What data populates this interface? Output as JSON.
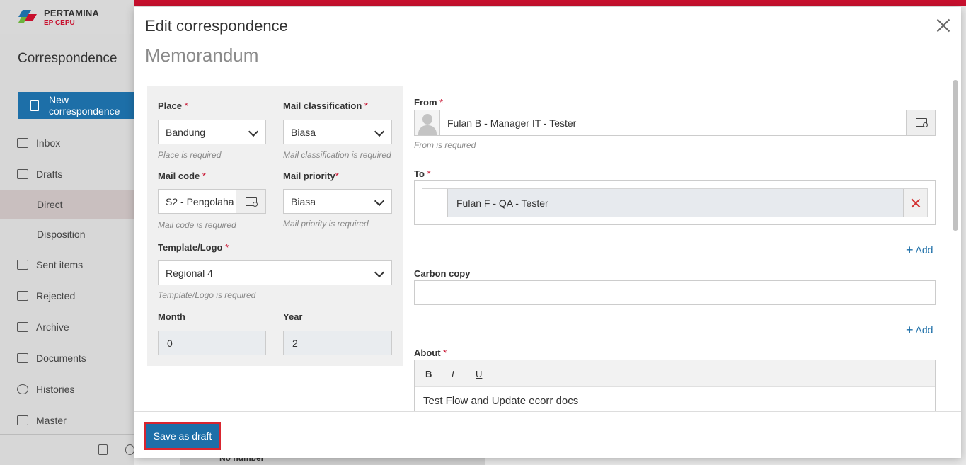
{
  "app": {
    "brand_name": "PERTAMINA",
    "brand_sub": "EP CEPU",
    "title": "Correspondence",
    "new_button": "New correspondence",
    "nav": [
      {
        "label": "Inbox"
      },
      {
        "label": "Drafts"
      },
      {
        "label": "Direct"
      },
      {
        "label": "Disposition"
      },
      {
        "label": "Sent items"
      },
      {
        "label": "Rejected"
      },
      {
        "label": "Archive"
      },
      {
        "label": "Documents"
      },
      {
        "label": "Histories"
      },
      {
        "label": "Master"
      }
    ],
    "bg_row_text": "No number"
  },
  "modal": {
    "title": "Edit correspondence",
    "subtitle": "Memorandum",
    "left": {
      "place": {
        "label": "Place",
        "value": "Bandung",
        "hint": "Place is required"
      },
      "classification": {
        "label": "Mail classification",
        "value": "Biasa",
        "hint": "Mail classification is required"
      },
      "mail_code": {
        "label": "Mail code",
        "value": "S2 - Pengolaha",
        "hint": "Mail code is required"
      },
      "priority": {
        "label": "Mail priority",
        "value": "Biasa",
        "hint": "Mail priority is required"
      },
      "template": {
        "label": "Template/Logo",
        "value": "Regional 4",
        "hint": "Template/Logo is required"
      },
      "month": {
        "label": "Month",
        "value": "0"
      },
      "year": {
        "label": "Year",
        "value": "2"
      }
    },
    "right": {
      "from": {
        "label": "From",
        "value": "Fulan B - Manager IT - Tester",
        "hint": "From is required"
      },
      "to": {
        "label": "To",
        "recipients": [
          {
            "name": "Fulan F - QA - Tester"
          }
        ]
      },
      "add_label": "Add",
      "cc": {
        "label": "Carbon copy",
        "value": ""
      },
      "about": {
        "label": "About",
        "toolbar": {
          "bold": "B",
          "italic": "I",
          "underline": "U"
        },
        "content": "Test Flow and Update ecorr docs"
      }
    },
    "required_mark": "*",
    "footer": {
      "save_label": "Save as draft"
    }
  },
  "colors": {
    "accent": "#1d6fa8",
    "brand_red": "#c8102e",
    "highlight_border": "#d9252f"
  }
}
